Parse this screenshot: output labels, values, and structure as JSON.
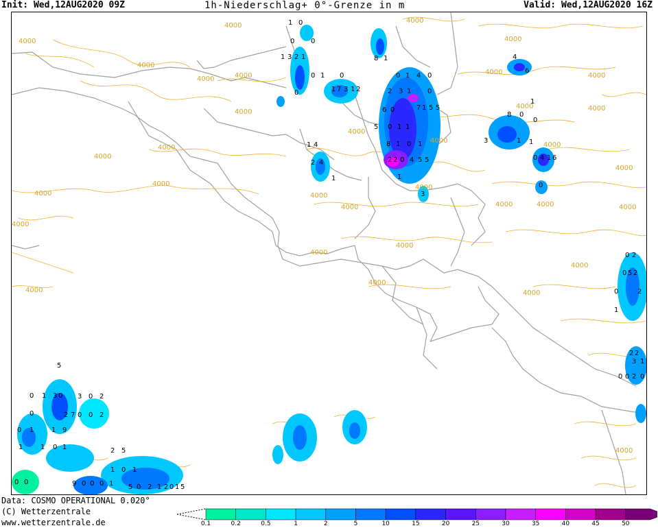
{
  "header": {
    "init": "Init: Wed,12AUG2020 09Z",
    "title": "1h-Niederschlag+ 0°-Grenze in m",
    "valid": "Valid: Wed,12AUG2020 16Z"
  },
  "footer": {
    "data_source": "Data: COSMO OPERATIONAL 0.020°",
    "copyright": "(C) Wetterzentrale",
    "website": "www.wetterzentrale.de"
  },
  "legend": {
    "ticks": [
      "0.1",
      "0.2",
      "0.5",
      "1",
      "2",
      "5",
      "10",
      "15",
      "20",
      "25",
      "30",
      "35",
      "40",
      "45",
      "50"
    ],
    "colors": [
      "#00f0a0",
      "#00e6c8",
      "#00e6ff",
      "#00c8ff",
      "#00a0ff",
      "#0078ff",
      "#0050ff",
      "#2a28ff",
      "#5a14ff",
      "#8a1eff",
      "#c81eff",
      "#ff00ff",
      "#d400c8",
      "#a0008c",
      "#780078"
    ]
  },
  "contour_labels": [
    "4000",
    "4000",
    "4000",
    "4000",
    "4000",
    "4000",
    "4000",
    "4000",
    "4000",
    "4000",
    "4000",
    "4000",
    "4000",
    "4000",
    "4000",
    "4000",
    "4000",
    "4000",
    "4000",
    "4000",
    "4000",
    "4000",
    "4000",
    "4000",
    "4000",
    "4000",
    "4000",
    "4000",
    "4000",
    "4000",
    "4000",
    "4000",
    "4000",
    "4000"
  ],
  "precip_values": [
    "1",
    "0",
    "0",
    "0",
    "1",
    "3",
    "2",
    "1",
    "0",
    "1",
    "0",
    "1",
    "7",
    "3",
    "1",
    "2",
    "0",
    "8",
    "1",
    "0",
    "1",
    "4",
    "0",
    "0",
    "2",
    "3",
    "1",
    "6",
    "0",
    "7",
    "1",
    "5",
    "5",
    "5",
    "0",
    "1",
    "1",
    "8",
    "1",
    "0",
    "1",
    "2",
    "2",
    "0",
    "4",
    "5",
    "5",
    "1",
    "3",
    "1",
    "4",
    "2",
    "4",
    "1",
    "4",
    "6",
    "8",
    "0",
    "1",
    "0",
    "3",
    "1",
    "1",
    "0",
    "4",
    "1",
    "6",
    "0",
    "0",
    "2",
    "0",
    "5",
    "2",
    "0",
    "2",
    "1",
    "2",
    "2",
    "3",
    "1",
    "0",
    "0",
    "2",
    "0",
    "0",
    "1",
    "3",
    "0",
    "5",
    "3",
    "0",
    "2",
    "2",
    "7",
    "0",
    "0",
    "2",
    "0",
    "0",
    "1",
    "1",
    "9",
    "1",
    "1",
    "0",
    "1",
    "2",
    "5",
    "1",
    "0",
    "1",
    "9",
    "0",
    "0",
    "0",
    "1",
    "5",
    "0",
    "2",
    "1",
    "2",
    "0",
    "1",
    "5",
    "0",
    "0"
  ]
}
